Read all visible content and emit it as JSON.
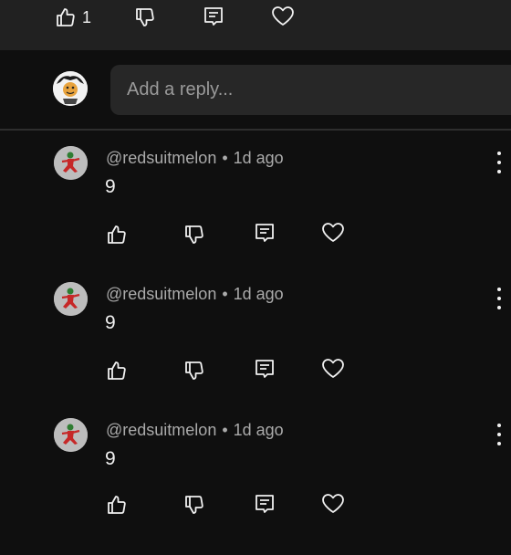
{
  "top_actions": {
    "like_count": "1",
    "icons": [
      "thumbs-up-icon",
      "thumbs-down-icon",
      "reply-icon",
      "heart-icon"
    ]
  },
  "reply_box": {
    "placeholder": "Add a reply..."
  },
  "comments": [
    {
      "author": "@redsuitmelon",
      "separator": "•",
      "time": "1d ago",
      "text": "9"
    },
    {
      "author": "@redsuitmelon",
      "separator": "•",
      "time": "1d ago",
      "text": "9"
    },
    {
      "author": "@redsuitmelon",
      "separator": "•",
      "time": "1d ago",
      "text": "9"
    }
  ],
  "colors": {
    "background": "#0f0f0f",
    "panel": "#212121",
    "input": "#272727",
    "text_primary": "#f1f1f1",
    "text_secondary": "#aaaaaa"
  }
}
